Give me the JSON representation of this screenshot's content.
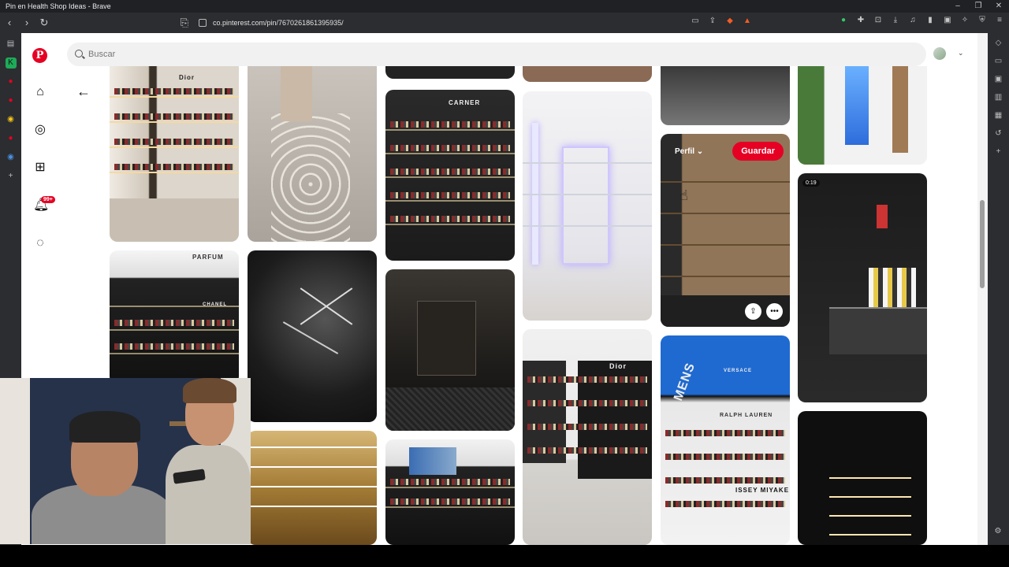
{
  "window": {
    "title": "Pin en Health Shop Ideas - Brave"
  },
  "browser": {
    "url": "co.pinterest.com/pin/7670261861395935/"
  },
  "pinterest": {
    "search_placeholder": "Buscar",
    "notification_count": "99+",
    "hover_pin": {
      "profile_label": "Perfil",
      "save_label": "Guardar"
    },
    "video_duration": "0:19",
    "shelf_texts": {
      "carner": "CARNER",
      "dior": "Dior",
      "parfum": "PARFUM",
      "chanel": "CHANEL",
      "mens": "MENS",
      "versace": "VERSACE",
      "ralph": "RALPH LAUREN",
      "issey": "ISSEY MIYAKE"
    }
  },
  "colors": {
    "brand": "#e60023",
    "browser_chrome": "#2b2d30"
  }
}
